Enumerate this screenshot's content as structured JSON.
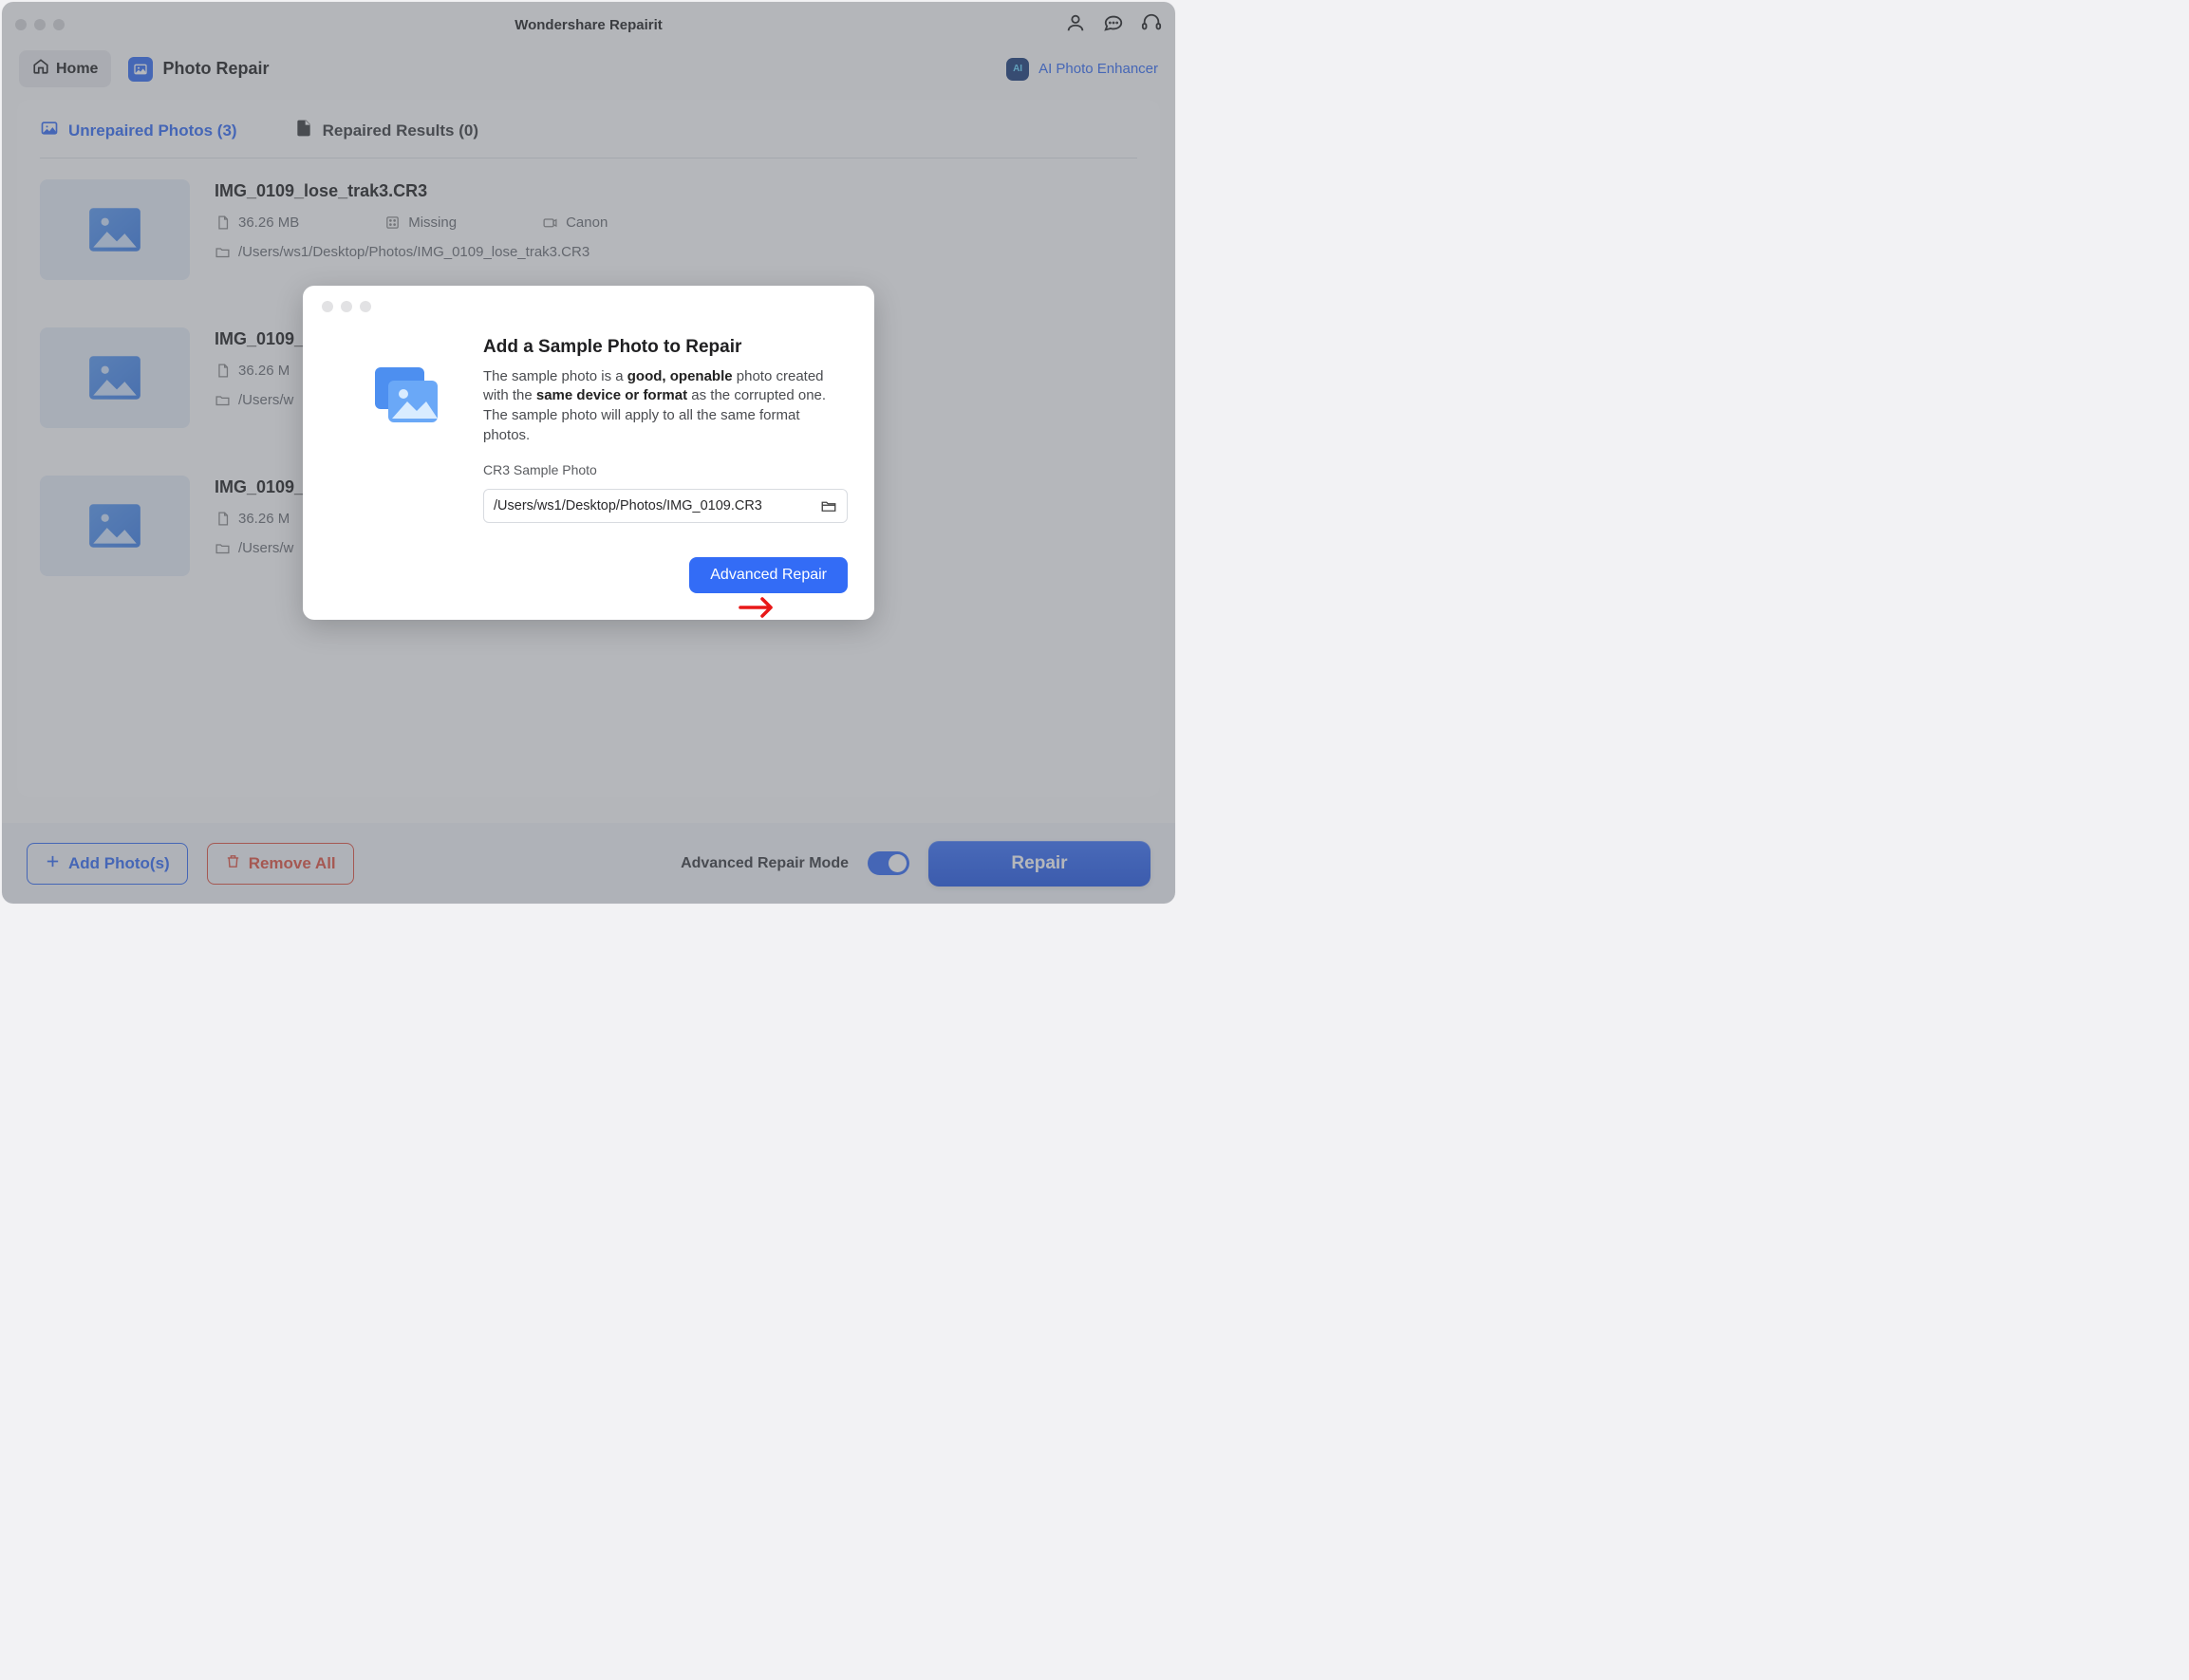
{
  "app_title": "Wondershare Repairit",
  "toolbar": {
    "home_label": "Home",
    "breadcrumb_label": "Photo Repair",
    "ai_enhancer_label": "AI Photo Enhancer"
  },
  "tabs": {
    "unrepaired": {
      "label": "Unrepaired Photos (3)"
    },
    "repaired": {
      "label": "Repaired Results (0)"
    }
  },
  "files": [
    {
      "name": "IMG_0109_lose_trak3.CR3",
      "size": "36.26 MB",
      "status": "Missing",
      "camera": "Canon",
      "path": "/Users/ws1/Desktop/Photos/IMG_0109_lose_trak3.CR3"
    },
    {
      "name": "IMG_0109_",
      "size": "36.26 M",
      "status": "",
      "camera": "",
      "path": "/Users/w"
    },
    {
      "name": "IMG_0109_",
      "size": "36.26 M",
      "status": "",
      "camera": "",
      "path": "/Users/w"
    }
  ],
  "bottom": {
    "add_label": "Add Photo(s)",
    "remove_label": "Remove All",
    "mode_label": "Advanced Repair Mode",
    "repair_label": "Repair"
  },
  "modal": {
    "title": "Add a Sample Photo to Repair",
    "desc_p1": "The sample photo is a ",
    "desc_b1": "good, openable",
    "desc_p2": " photo created with the ",
    "desc_b2": "same device or format",
    "desc_p3": " as the corrupted one. The sample photo will apply to all the same format photos.",
    "sample_label": "CR3 Sample Photo",
    "path_value": "/Users/ws1/Desktop/Photos/IMG_0109.CR3",
    "action_label": "Advanced Repair"
  }
}
